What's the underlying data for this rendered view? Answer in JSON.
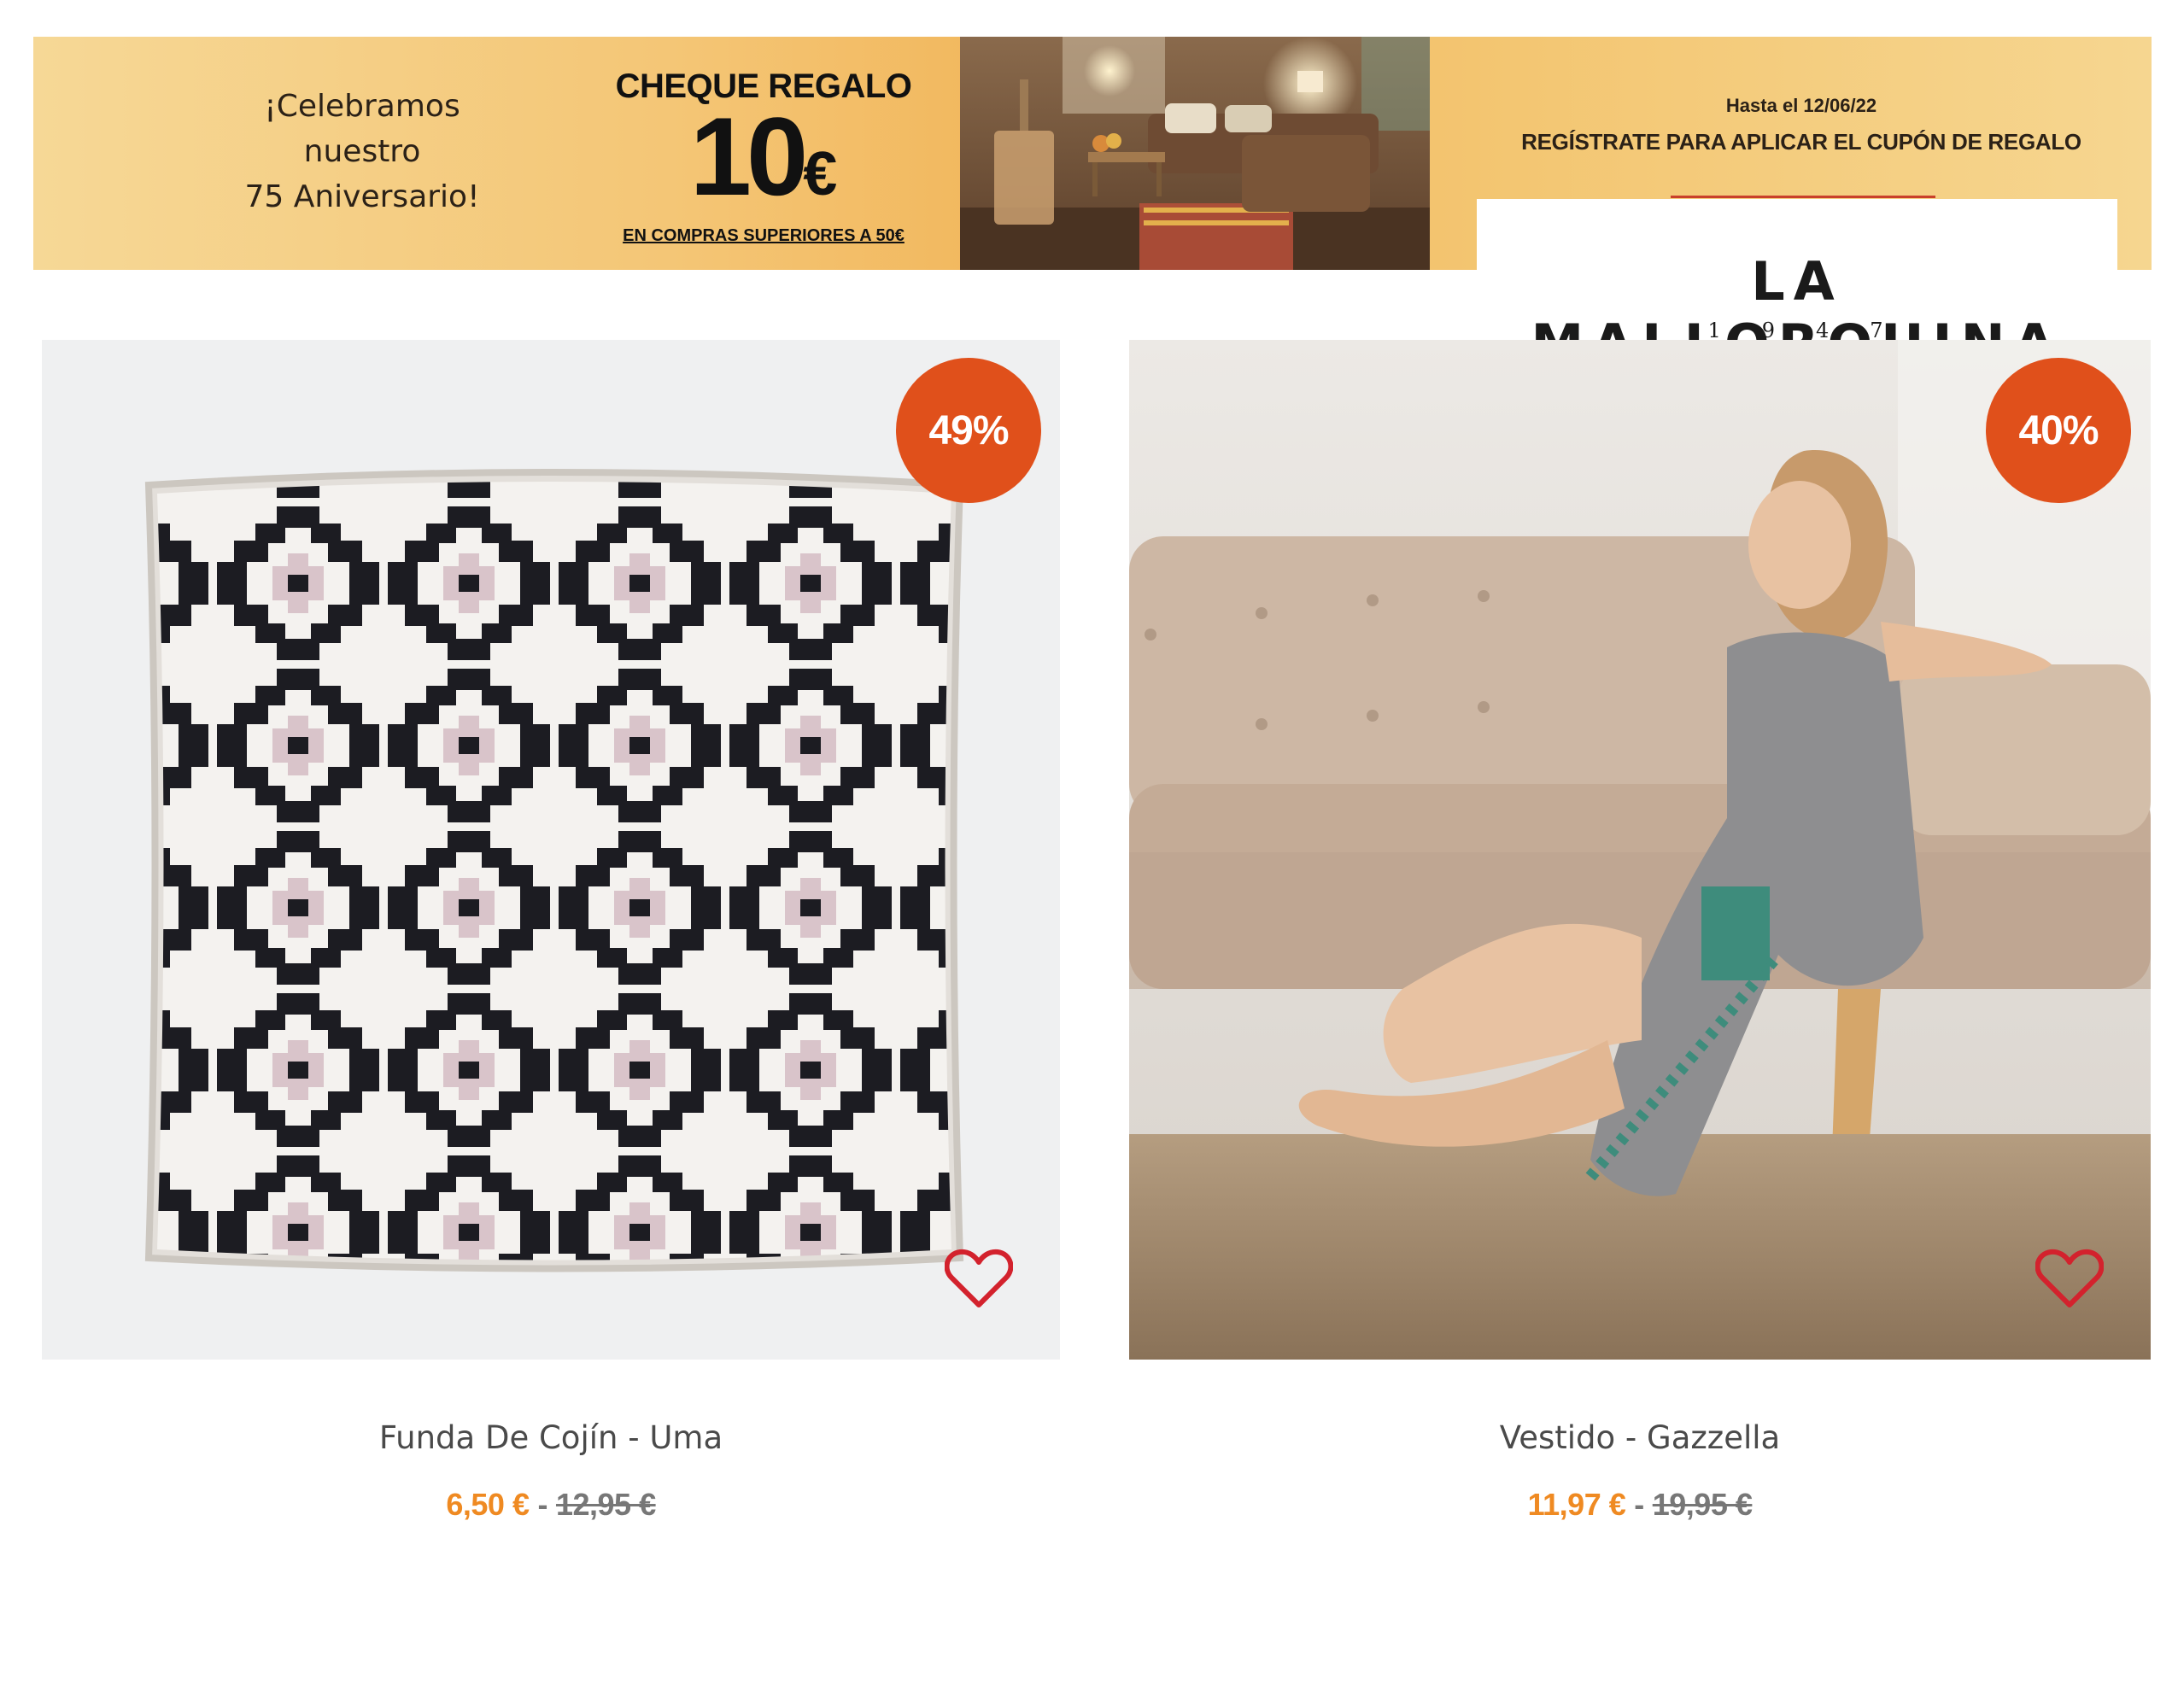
{
  "banner": {
    "celebrate_lines": [
      "¡Celebramos",
      "nuestro",
      "75 Aniversario!"
    ],
    "voucher_title": "CHEQUE REGALO",
    "voucher_amount": "10",
    "voucher_currency": "€",
    "voucher_condition": "EN COMPRAS SUPERIORES A 50€",
    "promo_date": "Hasta el 12/06/22",
    "promo_register": "REGÍSTRATE PARA APLICAR EL CUPÓN DE REGALO",
    "brand_name": "LA MALLORQUINA",
    "brand_year": "1947",
    "accent_color": "#f2b85e"
  },
  "products": [
    {
      "name": "Funda De Cojín - Uma",
      "discount": "49%",
      "price_sale": "6,50 €",
      "price_separator": "-",
      "price_original": "12,95 €",
      "wishlist_icon": "heart-outline-icon"
    },
    {
      "name": "Vestido - Gazzella",
      "discount": "40%",
      "price_sale": "11,97 €",
      "price_separator": "-",
      "price_original": "19,95 €",
      "wishlist_icon": "heart-outline-icon"
    }
  ],
  "colors": {
    "badge": "#e0501b",
    "sale_price": "#ef8a22",
    "heart": "#d3222d"
  }
}
